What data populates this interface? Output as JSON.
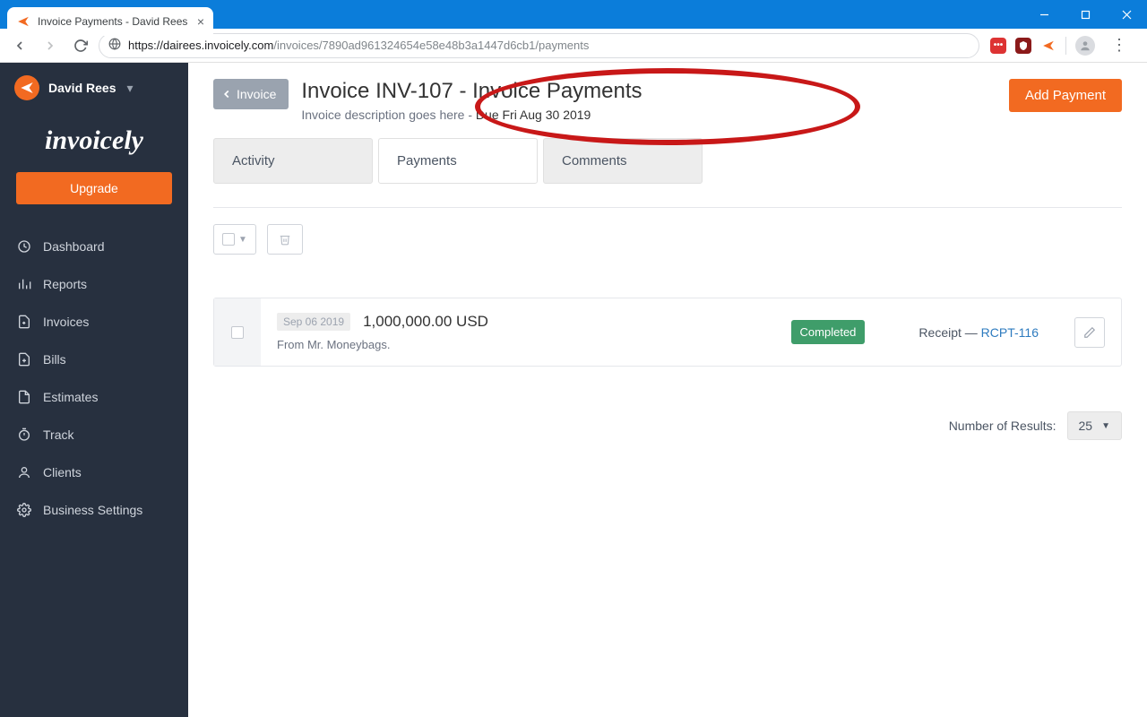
{
  "browser": {
    "tab_title": "Invoice Payments - David Rees",
    "url_host": "https://dairees.invoicely.com",
    "url_path": "/invoices/7890ad961324654e58e48b3a1447d6cb1/payments"
  },
  "sidebar": {
    "user_name": "David Rees",
    "brand": "invoicely",
    "upgrade_label": "Upgrade",
    "items": [
      {
        "label": "Dashboard"
      },
      {
        "label": "Reports"
      },
      {
        "label": "Invoices"
      },
      {
        "label": "Bills"
      },
      {
        "label": "Estimates"
      },
      {
        "label": "Track"
      },
      {
        "label": "Clients"
      },
      {
        "label": "Business Settings"
      }
    ]
  },
  "header": {
    "back_label": "Invoice",
    "title": "Invoice INV-107 - Invoice Payments",
    "description_prefix": "Invoice description goes here - ",
    "due_text": "Due Fri Aug 30 2019",
    "add_button": "Add Payment"
  },
  "tabs": {
    "activity": "Activity",
    "payments": "Payments",
    "comments": "Comments"
  },
  "payment": {
    "date": "Sep 06 2019",
    "amount": "1,000,000.00 USD",
    "from": "From Mr. Moneybags.",
    "status": "Completed",
    "receipt_prefix": "Receipt — ",
    "receipt_id": "RCPT-116"
  },
  "results": {
    "label": "Number of Results:",
    "value": "25"
  }
}
